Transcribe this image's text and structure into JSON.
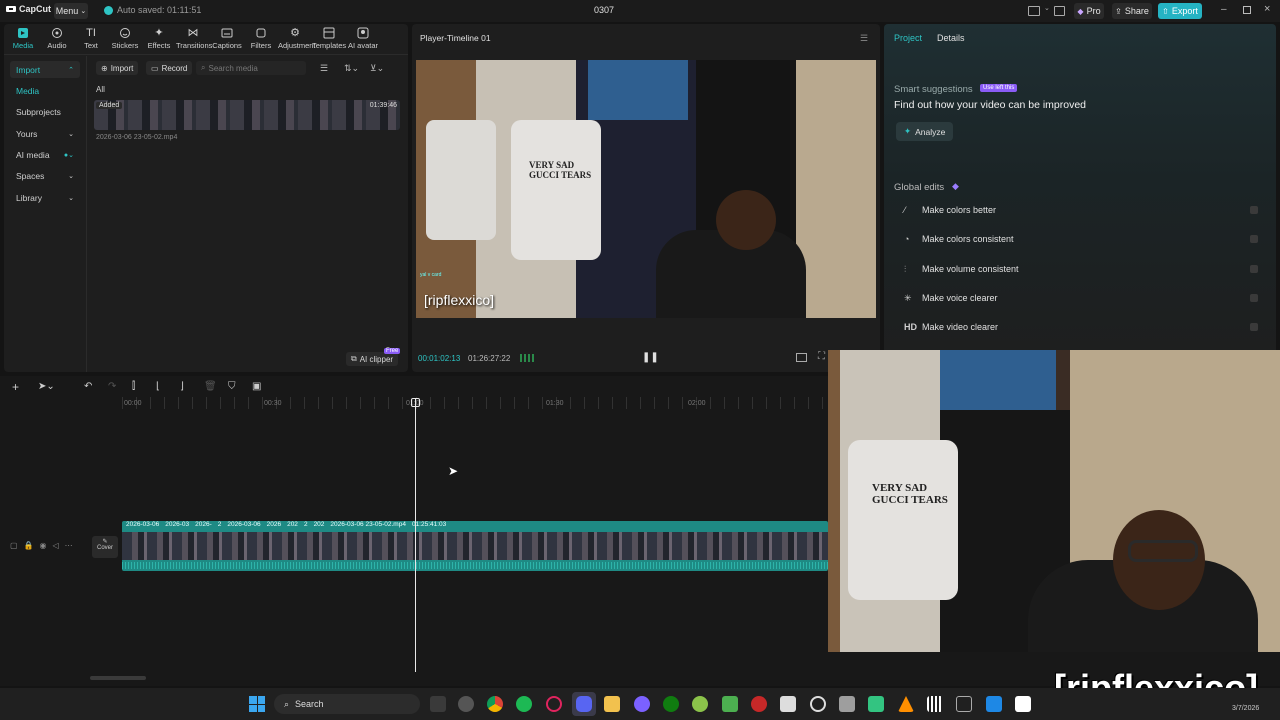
{
  "app": {
    "logo_text": "CapCut",
    "menu_label": "Menu",
    "autosave_text": "Auto saved: 01:11:51",
    "project_title": "0307",
    "pro_label": "Pro",
    "share_label": "Share",
    "export_label": "Export"
  },
  "toolbar": {
    "items": [
      {
        "label": "Media",
        "icon": "media-icon"
      },
      {
        "label": "Audio",
        "icon": "audio-icon"
      },
      {
        "label": "Text",
        "icon": "text-icon"
      },
      {
        "label": "Stickers",
        "icon": "sticker-icon"
      },
      {
        "label": "Effects",
        "icon": "effects-icon"
      },
      {
        "label": "Transitions",
        "icon": "transitions-icon"
      },
      {
        "label": "Captions",
        "icon": "captions-icon"
      },
      {
        "label": "Filters",
        "icon": "filters-icon"
      },
      {
        "label": "Adjustment",
        "icon": "adjustment-icon"
      },
      {
        "label": "Templates",
        "icon": "templates-icon"
      },
      {
        "label": "AI avatar",
        "icon": "ai-avatar-icon"
      }
    ]
  },
  "sidebar": {
    "items": [
      {
        "label": "Import"
      },
      {
        "label": "Media"
      },
      {
        "label": "Subprojects"
      },
      {
        "label": "Yours"
      },
      {
        "label": "AI media"
      },
      {
        "label": "Spaces"
      },
      {
        "label": "Library"
      }
    ]
  },
  "media": {
    "import_label": "Import",
    "record_label": "Record",
    "search_placeholder": "Search media",
    "filter_all": "All",
    "clip_added": "Added",
    "clip_duration": "01:39:46",
    "clip_name": "2026-03-06 23-05-02.mp4",
    "ai_clipper_label": "AI clipper",
    "ai_clipper_badge": "Free"
  },
  "player": {
    "title": "Player-Timeline 01",
    "caption": "[ripflexxico]",
    "overlay_small": "yal v card",
    "current_time": "00:01:02:13",
    "total_time": "01:26:27:22"
  },
  "right_panel": {
    "tab_project": "Project",
    "tab_details": "Details",
    "smart_title": "Smart suggestions",
    "smart_badge": "Use left this",
    "smart_heading": "Find out how your video can be improved",
    "analyze_label": "Analyze",
    "global_edits_title": "Global edits",
    "edits": [
      {
        "icon": "wand-icon",
        "label": "Make colors better"
      },
      {
        "icon": "palette-icon",
        "label": "Make colors consistent"
      },
      {
        "icon": "sliders-icon",
        "label": "Make volume consistent"
      },
      {
        "icon": "voice-icon",
        "label": "Make voice clearer"
      },
      {
        "icon": "hd-icon",
        "icon_text": "HD",
        "label": "Make video clearer"
      }
    ]
  },
  "timeline": {
    "ticks": [
      "00:00",
      "00:30",
      "01:00",
      "01:30",
      "02:00"
    ],
    "clip_labels": [
      "2026-03-06",
      "2026-03",
      "2026-",
      "2",
      "2026-03-06",
      "2026",
      "202",
      "2",
      "202"
    ],
    "main_clip_label": "2026-03-06 23-05-02.mp4",
    "main_clip_duration": "01:25:41:03",
    "cover_label": "Cover"
  },
  "overlay_cam": {
    "caption": "[ripflexxico]"
  },
  "taskbar": {
    "search_label": "Search",
    "clock_date": "3/7/2026"
  },
  "colors": {
    "accent": "#2ec4c4",
    "export": "#25b3c3",
    "panel": "#1e1e1e",
    "background": "#141414",
    "badge_purple": "#8a5cf6"
  }
}
